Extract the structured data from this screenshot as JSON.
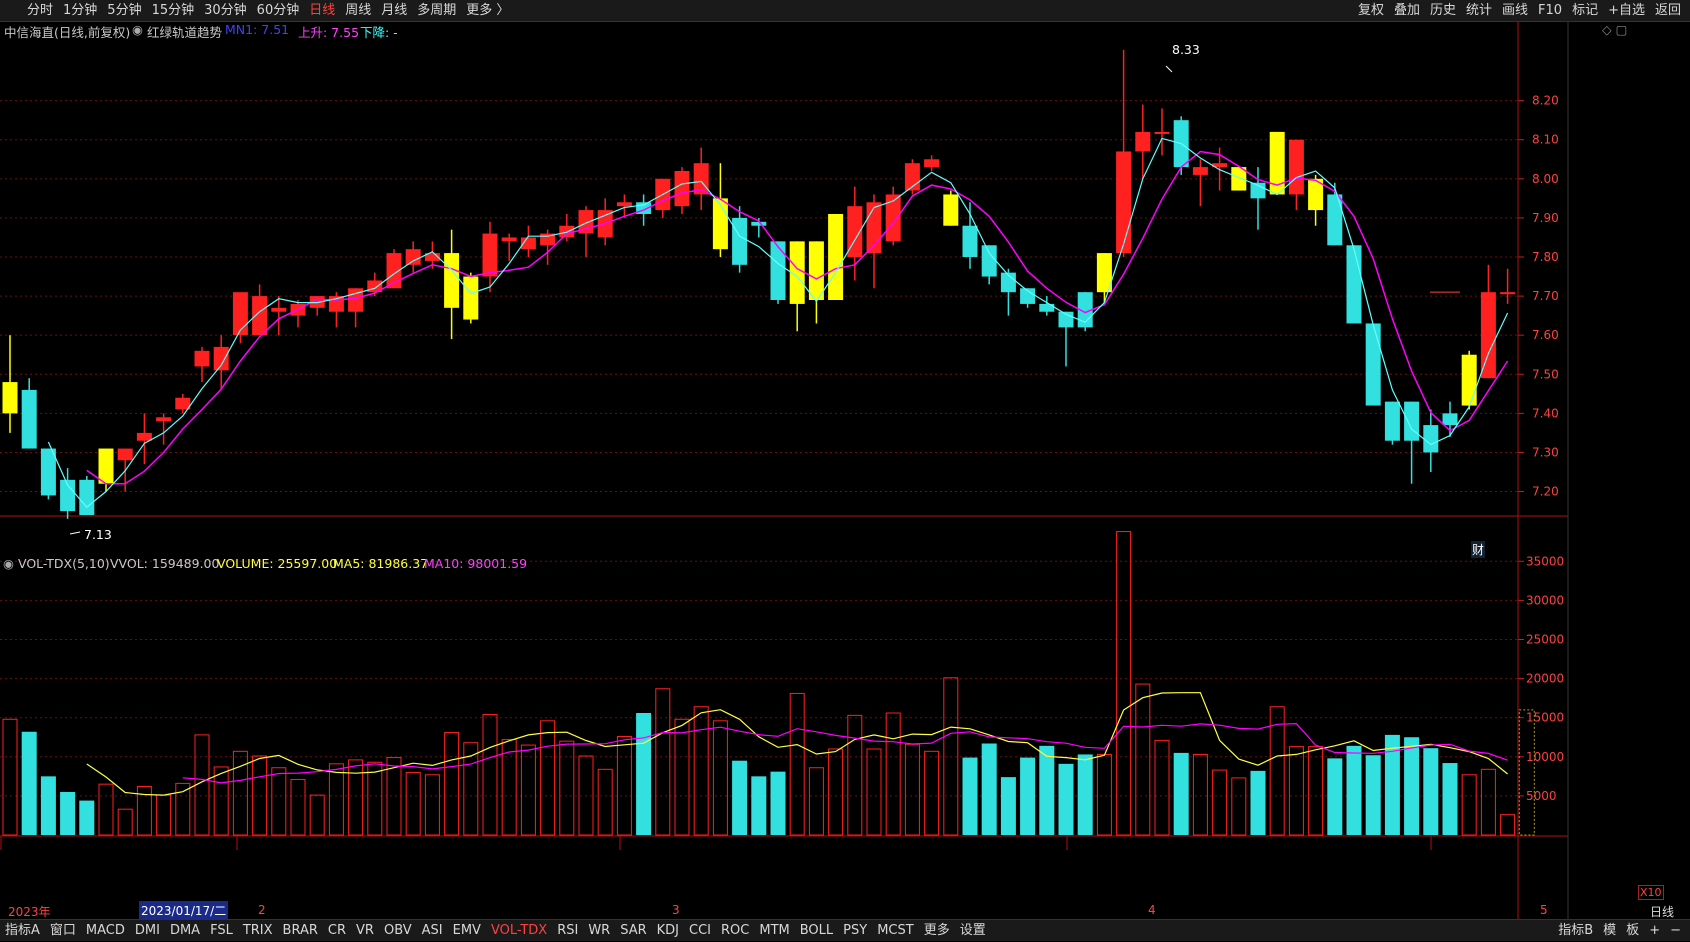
{
  "toolbar": {
    "periods": [
      "分时",
      "1分钟",
      "5分钟",
      "15分钟",
      "30分钟",
      "60分钟",
      "日线",
      "周线",
      "月线",
      "多周期",
      "更多 〉"
    ],
    "active_period": "日线",
    "right_items": [
      "复权",
      "叠加",
      "历史",
      "统计",
      "画线",
      "F10",
      "标记",
      "+自选",
      "返回"
    ]
  },
  "price_panel": {
    "title": "中信海直(日线,前复权)",
    "indicator": "红绿轨道趋势",
    "mn1_label": "MN1: 7.51",
    "up_label": "上升: 7.55",
    "down_label": "下降: -",
    "high_label": "8.33",
    "low_label": "7.13",
    "badge": "财",
    "yticks": [
      "8.20",
      "8.10",
      "8.00",
      "7.90",
      "7.80",
      "7.70",
      "7.60",
      "7.50",
      "7.40",
      "7.30",
      "7.20"
    ]
  },
  "volume_panel": {
    "name": "VOL-TDX(5,10)",
    "vvol": "VVOL: 159489.00",
    "volume": "VOLUME: 25597.00",
    "ma5": "MA5: 81986.37",
    "ma10": "MA10: 98001.59",
    "yticks": [
      "35000",
      "30000",
      "25000",
      "20000",
      "15000",
      "10000",
      "5000"
    ],
    "unit_badge": "X10"
  },
  "date_axis": {
    "labels": [
      "2023年",
      "2",
      "3",
      "4",
      "5"
    ],
    "cursor_date": "2023/01/17/二",
    "right_label": "日线"
  },
  "bottom_tabs": {
    "items": [
      "指标A",
      "窗口",
      "MACD",
      "DMI",
      "DMA",
      "FSL",
      "TRIX",
      "BRAR",
      "CR",
      "VR",
      "OBV",
      "ASI",
      "EMV",
      "VOL-TDX",
      "RSI",
      "WR",
      "SAR",
      "KDJ",
      "CCI",
      "ROC",
      "MTM",
      "BOLL",
      "PSY",
      "MCST",
      "更多",
      "设置"
    ],
    "active": "VOL-TDX",
    "right_items": [
      "指标B",
      "模",
      "板",
      "+",
      "−"
    ]
  },
  "colors": {
    "up": "#ff2020",
    "down": "#33e0e0",
    "yellow": "#ffff00",
    "ma_pink": "#ff00ff",
    "ma_cyan": "#60ffff",
    "ma_yellow": "#ffff40",
    "grid": "#6a1010"
  },
  "chart_data": {
    "type": "candlestick",
    "title": "中信海直(日线,前复权)",
    "ylim": [
      7.14,
      8.35
    ],
    "volume_ylim": [
      0,
      39000
    ],
    "candles": [
      {
        "o": 7.4,
        "h": 7.6,
        "l": 7.35,
        "c": 7.48,
        "k": "y",
        "v": 14800
      },
      {
        "o": 7.46,
        "h": 7.49,
        "l": 7.31,
        "c": 7.31,
        "k": "c",
        "v": 13200
      },
      {
        "o": 7.31,
        "h": 7.31,
        "l": 7.18,
        "c": 7.19,
        "k": "c",
        "v": 7500
      },
      {
        "o": 7.23,
        "h": 7.26,
        "l": 7.13,
        "c": 7.15,
        "k": "c",
        "v": 5500
      },
      {
        "o": 7.23,
        "h": 7.24,
        "l": 7.14,
        "c": 7.14,
        "k": "c",
        "v": 4400
      },
      {
        "o": 7.22,
        "h": 7.31,
        "l": 7.2,
        "c": 7.31,
        "k": "y",
        "v": 6500
      },
      {
        "o": 7.28,
        "h": 7.31,
        "l": 7.2,
        "c": 7.31,
        "k": "r",
        "v": 3300
      },
      {
        "o": 7.33,
        "h": 7.4,
        "l": 7.27,
        "c": 7.35,
        "k": "r",
        "v": 6200
      },
      {
        "o": 7.38,
        "h": 7.4,
        "l": 7.32,
        "c": 7.39,
        "k": "r",
        "v": 5100
      },
      {
        "o": 7.41,
        "h": 7.45,
        "l": 7.4,
        "c": 7.44,
        "k": "r",
        "v": 6600
      },
      {
        "o": 7.52,
        "h": 7.57,
        "l": 7.48,
        "c": 7.56,
        "k": "r",
        "v": 12800
      },
      {
        "o": 7.51,
        "h": 7.6,
        "l": 7.46,
        "c": 7.57,
        "k": "r",
        "v": 8700
      },
      {
        "o": 7.6,
        "h": 7.69,
        "l": 7.58,
        "c": 7.71,
        "k": "r",
        "v": 10700
      },
      {
        "o": 7.6,
        "h": 7.73,
        "l": 7.6,
        "c": 7.7,
        "k": "r",
        "v": 10100
      },
      {
        "o": 7.66,
        "h": 7.7,
        "l": 7.6,
        "c": 7.67,
        "k": "r",
        "v": 8600
      },
      {
        "o": 7.65,
        "h": 7.69,
        "l": 7.62,
        "c": 7.68,
        "k": "r",
        "v": 7100
      },
      {
        "o": 7.67,
        "h": 7.7,
        "l": 7.65,
        "c": 7.7,
        "k": "r",
        "v": 5100
      },
      {
        "o": 7.66,
        "h": 7.71,
        "l": 7.62,
        "c": 7.7,
        "k": "r",
        "v": 9100
      },
      {
        "o": 7.66,
        "h": 7.72,
        "l": 7.62,
        "c": 7.72,
        "k": "r",
        "v": 9600
      },
      {
        "o": 7.71,
        "h": 7.76,
        "l": 7.7,
        "c": 7.74,
        "k": "r",
        "v": 9300
      },
      {
        "o": 7.72,
        "h": 7.82,
        "l": 7.72,
        "c": 7.81,
        "k": "r",
        "v": 9900
      },
      {
        "o": 7.78,
        "h": 7.84,
        "l": 7.76,
        "c": 7.82,
        "k": "r",
        "v": 8000
      },
      {
        "o": 7.79,
        "h": 7.84,
        "l": 7.77,
        "c": 7.81,
        "k": "r",
        "v": 7700
      },
      {
        "o": 7.81,
        "h": 7.87,
        "l": 7.59,
        "c": 7.67,
        "k": "y",
        "v": 13100
      },
      {
        "o": 7.75,
        "h": 7.76,
        "l": 7.63,
        "c": 7.64,
        "k": "y",
        "v": 11800
      },
      {
        "o": 7.75,
        "h": 7.89,
        "l": 7.71,
        "c": 7.86,
        "k": "r",
        "v": 15400
      },
      {
        "o": 7.84,
        "h": 7.86,
        "l": 7.79,
        "c": 7.85,
        "k": "r",
        "v": 12200
      },
      {
        "o": 7.82,
        "h": 7.88,
        "l": 7.8,
        "c": 7.85,
        "k": "r",
        "v": 11500
      },
      {
        "o": 7.83,
        "h": 7.87,
        "l": 7.78,
        "c": 7.86,
        "k": "r",
        "v": 14600
      },
      {
        "o": 7.85,
        "h": 7.91,
        "l": 7.84,
        "c": 7.88,
        "k": "r",
        "v": 12000
      },
      {
        "o": 7.86,
        "h": 7.93,
        "l": 7.8,
        "c": 7.92,
        "k": "r",
        "v": 10100
      },
      {
        "o": 7.85,
        "h": 7.95,
        "l": 7.83,
        "c": 7.92,
        "k": "r",
        "v": 8400
      },
      {
        "o": 7.93,
        "h": 7.96,
        "l": 7.9,
        "c": 7.94,
        "k": "r",
        "v": 12600
      },
      {
        "o": 7.91,
        "h": 7.96,
        "l": 7.88,
        "c": 7.94,
        "k": "c",
        "v": 15600
      },
      {
        "o": 7.92,
        "h": 8.0,
        "l": 7.9,
        "c": 8.0,
        "k": "r",
        "v": 18700
      },
      {
        "o": 7.93,
        "h": 8.03,
        "l": 7.91,
        "c": 8.02,
        "k": "r",
        "v": 14800
      },
      {
        "o": 8.04,
        "h": 8.08,
        "l": 7.92,
        "c": 7.96,
        "k": "r",
        "v": 16400
      },
      {
        "o": 7.95,
        "h": 8.04,
        "l": 7.8,
        "c": 7.82,
        "k": "y",
        "v": 14600
      },
      {
        "o": 7.9,
        "h": 7.93,
        "l": 7.76,
        "c": 7.78,
        "k": "c",
        "v": 9500
      },
      {
        "o": 7.89,
        "h": 7.9,
        "l": 7.85,
        "c": 7.88,
        "k": "c",
        "v": 7500
      },
      {
        "o": 7.84,
        "h": 7.84,
        "l": 7.68,
        "c": 7.69,
        "k": "c",
        "v": 8100
      },
      {
        "o": 7.84,
        "h": 7.84,
        "l": 7.61,
        "c": 7.68,
        "k": "y",
        "v": 18100
      },
      {
        "o": 7.84,
        "h": 7.84,
        "l": 7.63,
        "c": 7.69,
        "k": "y",
        "v": 8600
      },
      {
        "o": 7.69,
        "h": 7.91,
        "l": 7.69,
        "c": 7.91,
        "k": "y",
        "v": 11000
      },
      {
        "o": 7.8,
        "h": 7.98,
        "l": 7.74,
        "c": 7.93,
        "k": "r",
        "v": 15300
      },
      {
        "o": 7.81,
        "h": 7.96,
        "l": 7.72,
        "c": 7.94,
        "k": "r",
        "v": 11000
      },
      {
        "o": 7.84,
        "h": 7.98,
        "l": 7.83,
        "c": 7.96,
        "k": "r",
        "v": 15600
      },
      {
        "o": 7.97,
        "h": 8.05,
        "l": 7.96,
        "c": 8.04,
        "k": "r",
        "v": 11600
      },
      {
        "o": 8.03,
        "h": 8.06,
        "l": 8.02,
        "c": 8.05,
        "k": "r",
        "v": 10700
      },
      {
        "o": 7.96,
        "h": 7.97,
        "l": 7.88,
        "c": 7.88,
        "k": "y",
        "v": 20100
      },
      {
        "o": 7.88,
        "h": 7.94,
        "l": 7.77,
        "c": 7.8,
        "k": "c",
        "v": 9900
      },
      {
        "o": 7.83,
        "h": 7.83,
        "l": 7.73,
        "c": 7.75,
        "k": "c",
        "v": 11700
      },
      {
        "o": 7.76,
        "h": 7.77,
        "l": 7.65,
        "c": 7.71,
        "k": "c",
        "v": 7400
      },
      {
        "o": 7.72,
        "h": 7.72,
        "l": 7.67,
        "c": 7.68,
        "k": "c",
        "v": 9900
      },
      {
        "o": 7.68,
        "h": 7.7,
        "l": 7.65,
        "c": 7.66,
        "k": "c",
        "v": 11400
      },
      {
        "o": 7.66,
        "h": 7.66,
        "l": 7.52,
        "c": 7.62,
        "k": "c",
        "v": 9100
      },
      {
        "o": 7.71,
        "h": 7.71,
        "l": 7.61,
        "c": 7.62,
        "k": "c",
        "v": 10300
      },
      {
        "o": 7.71,
        "h": 7.81,
        "l": 7.68,
        "c": 7.81,
        "k": "y",
        "v": 10300
      },
      {
        "o": 7.81,
        "h": 8.33,
        "l": 7.8,
        "c": 8.07,
        "k": "r",
        "v": 38800
      },
      {
        "o": 8.07,
        "h": 8.19,
        "l": 8.0,
        "c": 8.12,
        "k": "r",
        "v": 19300
      },
      {
        "o": 8.12,
        "h": 8.18,
        "l": 8.06,
        "c": 8.12,
        "k": "r",
        "v": 12100
      },
      {
        "o": 8.15,
        "h": 8.16,
        "l": 8.01,
        "c": 8.03,
        "k": "c",
        "v": 10500
      },
      {
        "o": 8.03,
        "h": 8.05,
        "l": 7.93,
        "c": 8.01,
        "k": "r",
        "v": 10300
      },
      {
        "o": 8.04,
        "h": 8.08,
        "l": 7.97,
        "c": 8.03,
        "k": "r",
        "v": 8300
      },
      {
        "o": 8.03,
        "h": 8.03,
        "l": 7.97,
        "c": 7.97,
        "k": "y",
        "v": 7300
      },
      {
        "o": 7.99,
        "h": 8.03,
        "l": 7.87,
        "c": 7.95,
        "k": "c",
        "v": 8200
      },
      {
        "o": 8.12,
        "h": 8.12,
        "l": 7.96,
        "c": 7.96,
        "k": "y",
        "v": 16400
      },
      {
        "o": 7.96,
        "h": 8.1,
        "l": 7.92,
        "c": 8.1,
        "k": "r",
        "v": 11300
      },
      {
        "o": 7.92,
        "h": 8.01,
        "l": 7.88,
        "c": 8.0,
        "k": "y",
        "v": 11300
      },
      {
        "o": 7.96,
        "h": 7.99,
        "l": 7.83,
        "c": 7.83,
        "k": "c",
        "v": 9800
      },
      {
        "o": 7.83,
        "h": 7.83,
        "l": 7.63,
        "c": 7.63,
        "k": "c",
        "v": 11400
      },
      {
        "o": 7.63,
        "h": 7.63,
        "l": 7.42,
        "c": 7.42,
        "k": "c",
        "v": 10200
      },
      {
        "o": 7.43,
        "h": 7.43,
        "l": 7.32,
        "c": 7.33,
        "k": "c",
        "v": 12800
      },
      {
        "o": 7.43,
        "h": 7.43,
        "l": 7.22,
        "c": 7.33,
        "k": "c",
        "v": 12500
      },
      {
        "o": 7.37,
        "h": 7.41,
        "l": 7.25,
        "c": 7.3,
        "k": "c",
        "v": 11100
      },
      {
        "o": 7.37,
        "h": 7.43,
        "l": 7.34,
        "c": 7.4,
        "k": "c",
        "v": 9200
      },
      {
        "o": 7.42,
        "h": 7.56,
        "l": 7.41,
        "c": 7.55,
        "k": "y",
        "v": 7700
      },
      {
        "o": 7.49,
        "h": 7.78,
        "l": 7.49,
        "c": 7.71,
        "k": "r",
        "v": 8400
      },
      {
        "o": 7.71,
        "h": 7.77,
        "l": 7.68,
        "c": 7.71,
        "k": "r",
        "v": 2600
      }
    ]
  }
}
